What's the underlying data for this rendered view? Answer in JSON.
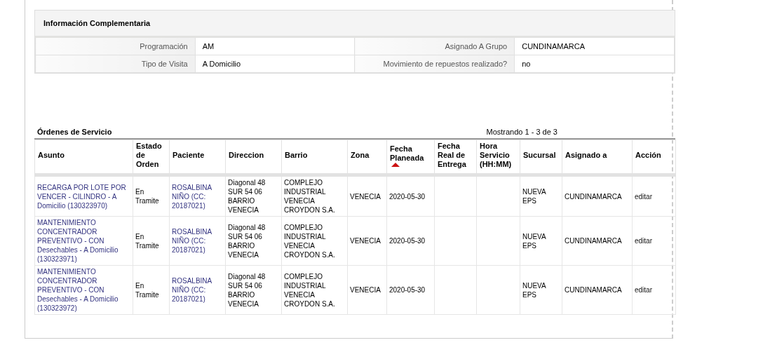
{
  "info_panel": {
    "title": "Información Complementaria",
    "rows": [
      {
        "cells": [
          {
            "label": "Programación",
            "value": "AM"
          },
          {
            "label": "Asignado A Grupo",
            "value": "CUNDINAMARCA"
          }
        ]
      },
      {
        "cells": [
          {
            "label": "Tipo de Visita",
            "value": "A Domicilio"
          },
          {
            "label": "Movimiento de repuestos realizado?",
            "value": "no"
          }
        ]
      }
    ]
  },
  "orders": {
    "title": "Órdenes de Servicio",
    "pagination": "Mostrando 1 - 3 de 3",
    "columns": [
      {
        "label": "Asunto",
        "sorted": false
      },
      {
        "label": "Estado de Orden",
        "sorted": false
      },
      {
        "label": "Paciente",
        "sorted": false
      },
      {
        "label": "Direccion",
        "sorted": false
      },
      {
        "label": "Barrio",
        "sorted": false
      },
      {
        "label": "Zona",
        "sorted": false
      },
      {
        "label": "Fecha Planeada",
        "sorted": true
      },
      {
        "label": "Fecha Real de Entrega",
        "sorted": false
      },
      {
        "label": "Hora Servicio (HH:MM)",
        "sorted": false
      },
      {
        "label": "Sucursal",
        "sorted": false
      },
      {
        "label": "Asignado a",
        "sorted": false
      },
      {
        "label": "Acción",
        "sorted": false
      }
    ],
    "rows": [
      {
        "asunto": "RECARGA POR LOTE POR VENCER - CILINDRO - A Domicilio (130323970)",
        "estado": "En Tramite",
        "paciente": "ROSALBINA NIÑO (CC: 20187021)",
        "direccion": "Diagonal 48 SUR 54 06 BARRIO VENECIA",
        "barrio": "COMPLEJO INDUSTRIAL VENECIA CROYDON S.A.",
        "zona": "VENECIA",
        "fecha_planeada": "2020-05-30",
        "sucursal": "NUEVA EPS",
        "asignado": "CUNDINAMARCA",
        "accion": "editar"
      },
      {
        "asunto": "MANTENIMIENTO CONCENTRADOR PREVENTIVO - CON Desechables - A Domicilio (130323971)",
        "estado": "En Tramite",
        "paciente": "ROSALBINA NIÑO (CC: 20187021)",
        "direccion": "Diagonal 48 SUR 54 06 BARRIO VENECIA",
        "barrio": "COMPLEJO INDUSTRIAL VENECIA CROYDON S.A.",
        "zona": "VENECIA",
        "fecha_planeada": "2020-05-30",
        "sucursal": "NUEVA EPS",
        "asignado": "CUNDINAMARCA",
        "accion": "editar"
      },
      {
        "asunto": "MANTENIMIENTO CONCENTRADOR PREVENTIVO - CON Desechables - A Domicilio (130323972)",
        "estado": "En Tramite",
        "paciente": "ROSALBINA NIÑO (CC: 20187021)",
        "direccion": "Diagonal 48 SUR 54 06 BARRIO VENECIA",
        "barrio": "COMPLEJO INDUSTRIAL VENECIA CROYDON S.A.",
        "zona": "VENECIA",
        "fecha_planeada": "2020-05-30",
        "sucursal": "NUEVA EPS",
        "asignado": "CUNDINAMARCA",
        "accion": "editar"
      }
    ]
  }
}
